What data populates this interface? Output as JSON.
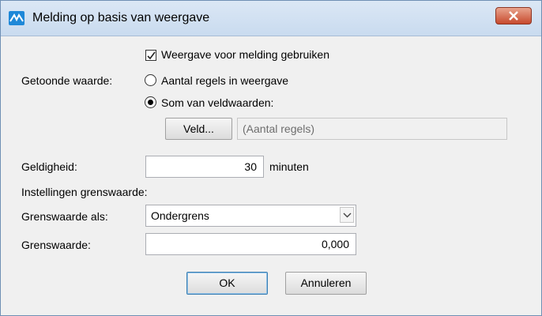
{
  "window": {
    "title": "Melding op basis van weergave"
  },
  "icons": {
    "app": "chart-line-icon",
    "close": "close-icon"
  },
  "form": {
    "use_view_checkbox": {
      "label": "Weergave voor melding gebruiken",
      "checked": true
    },
    "displayed_value_label": "Getoonde waarde:",
    "radio_row_count": {
      "label": "Aantal regels in weergave",
      "selected": false
    },
    "radio_field_sum": {
      "label": "Som van veldwaarden:",
      "selected": true
    },
    "field_button_label": "Veld...",
    "field_value": "(Aantal regels)",
    "validity_label": "Geldigheid:",
    "validity_value": "30",
    "validity_unit": "minuten",
    "threshold_section_label": "Instellingen grenswaarde:",
    "threshold_type_label": "Grenswaarde als:",
    "threshold_type_value": "Ondergrens",
    "threshold_value_label": "Grenswaarde:",
    "threshold_value": "0,000"
  },
  "buttons": {
    "ok": "OK",
    "cancel": "Annuleren"
  },
  "colors": {
    "titlebar": "#c9dbef",
    "accent": "#1e88d8",
    "close": "#c74a2d"
  }
}
